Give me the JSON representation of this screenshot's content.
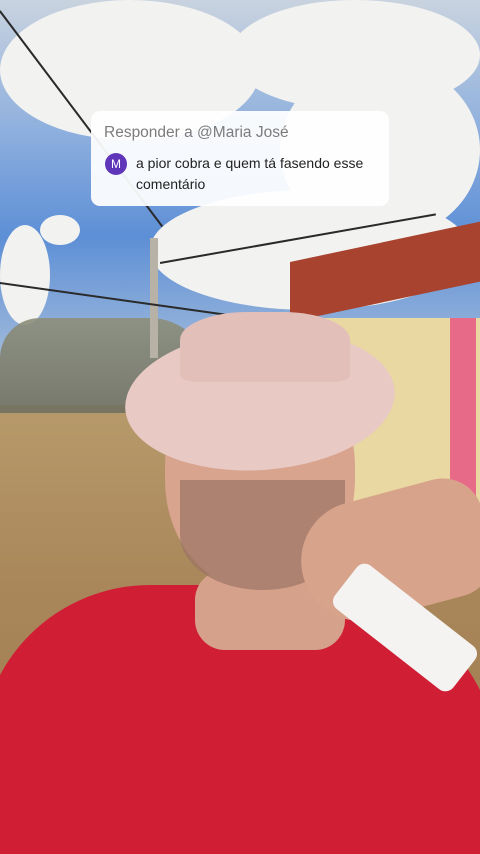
{
  "reply_card": {
    "header": "Responder a @Maria José",
    "avatar_initial": "M",
    "comment_text": "a pior cobra e quem tá fasendo esse comentário"
  },
  "colors": {
    "avatar": "#5f35b9",
    "shirt": "#d01f35"
  }
}
